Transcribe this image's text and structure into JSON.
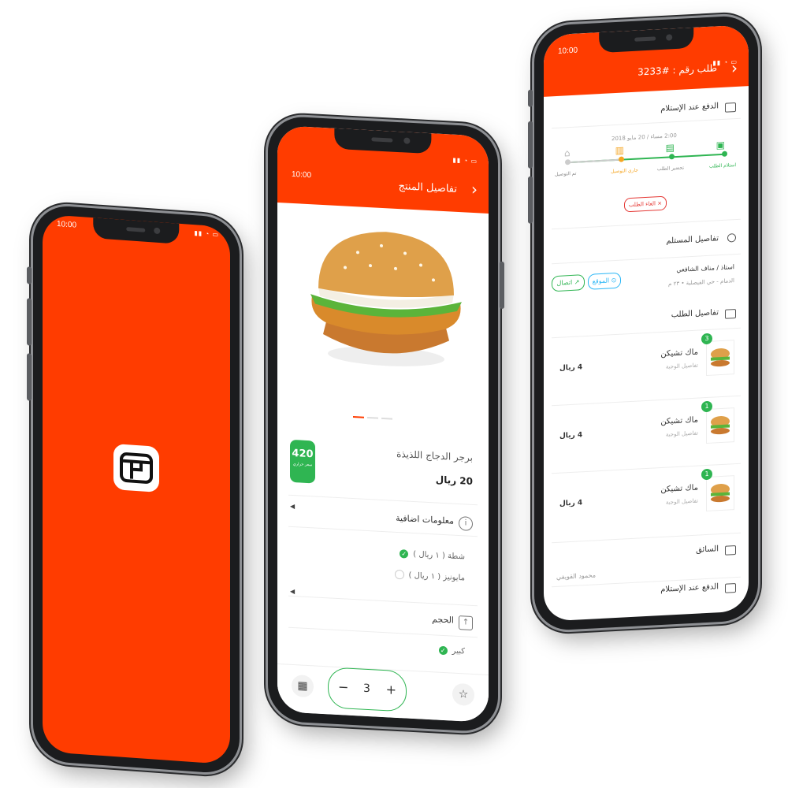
{
  "status_time": "10:00",
  "phone1": {
    "logo_icon": "store-icon"
  },
  "phone2": {
    "title": "تفاصيل المنتج",
    "product_name": "برجر الدجاج اللذيذة",
    "price": "20 ريال",
    "calories": "420",
    "calories_unit": "سعر حراري",
    "extra_info_title": "معلومات اضافية",
    "extras": [
      {
        "label": "شطة  ( ١ ريال )",
        "checked": true
      },
      {
        "label": "مايونيز  ( ١ ريال )",
        "checked": false
      }
    ],
    "size_title": "الحجم",
    "size_option": "كبير",
    "quantity": "3",
    "minus": "−",
    "plus": "+"
  },
  "phone3": {
    "title": "طلب رقم : #3233",
    "payment_title": "الدفع عند الإستلام",
    "date": "2:00 مساء / 20 مايو 2018",
    "steps": [
      "استلام الطلب",
      "تحضير الطلب",
      "جاري التوصيل",
      "تم التوصيل"
    ],
    "cancel_label": "الغاء الطلب",
    "recipient_title": "تفاصيل المستلم",
    "recipient_name": "استاذ / مناف الشافعي",
    "recipient_address": "الدمام - حي الفيصلية • ٢٣ م",
    "location_label": "الموقع",
    "call_label": "اتصال",
    "order_details_title": "تفاصيل الطلب",
    "items": [
      {
        "qty": "3",
        "name": "ماك تشيكن",
        "meal": "تفاصيل الوجبة",
        "price": "4 ريال"
      },
      {
        "qty": "1",
        "name": "ماك تشيكن",
        "meal": "تفاصيل الوجبة",
        "price": "4 ريال"
      },
      {
        "qty": "1",
        "name": "ماك تشيكن",
        "meal": "تفاصيل الوجبة",
        "price": "4 ريال"
      }
    ],
    "driver_title": "السائق",
    "driver_name": "محمود القويفي",
    "payment_footer": "الدفع عند الإستلام"
  },
  "colors": {
    "brand": "#ff3c00",
    "success": "#2fb552",
    "danger": "#e53935",
    "info": "#29b6f6"
  }
}
